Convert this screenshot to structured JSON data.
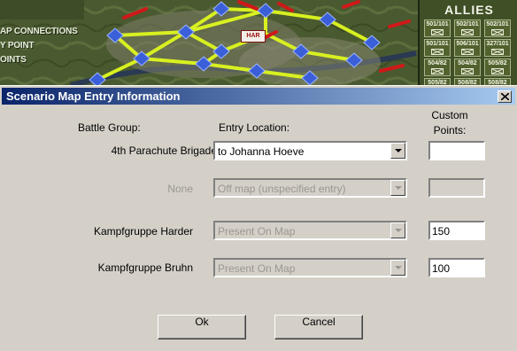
{
  "background": {
    "legend_lines": [
      "AP CONNECTIONS",
      "Y POINT",
      "OINTS"
    ],
    "city_marker": "HAR",
    "allies_panel": {
      "title": "ALLIES",
      "unit_tiles": [
        "501/101",
        "501/101",
        "502/101",
        "502/101",
        "506/101",
        "327/101",
        "504/82",
        "504/82",
        "505/82",
        "505/82",
        "508/82",
        "508/82"
      ]
    }
  },
  "dialog": {
    "title": "Scenario Map Entry Information",
    "close_icon": "close-icon",
    "headers": {
      "battle_group": "Battle Group:",
      "entry_location": "Entry Location:",
      "custom_points_line1": "Custom",
      "custom_points_line2": "Points:"
    },
    "rows": [
      {
        "group": "4th Parachute Brigade",
        "entry": "to Johanna Hoeve",
        "points": "",
        "enabled": true
      },
      {
        "group": "None",
        "entry": "Off map (unspecified entry)",
        "points": "",
        "enabled": false
      },
      {
        "group": "Kampfgruppe Harder",
        "entry": "Present On Map",
        "points": "150",
        "enabled": false
      },
      {
        "group": "Kampfgruppe Bruhn",
        "entry": "Present On Map",
        "points": "100",
        "enabled": false
      }
    ],
    "ok_label": "Ok",
    "cancel_label": "Cancel"
  },
  "colors": {
    "titlebar_start": "#0a246a",
    "titlebar_end": "#a6caf0",
    "dialog_face": "#d4d0c8",
    "disabled_text": "#9a978f",
    "map_route": "#d8f020",
    "map_node": "#3a5fd8",
    "map_arrow": "#d01818"
  }
}
